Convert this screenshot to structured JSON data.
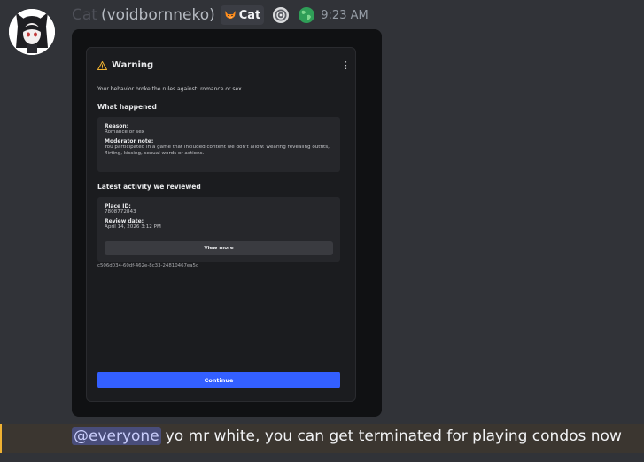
{
  "author": {
    "display_prefix": "Cat",
    "handle": "(voidbornneko)",
    "tag_label": "Cat",
    "time": "9:23 AM",
    "avatar_icon": "anime-cat-girl-avatar",
    "tag_icon": "fox-icon",
    "badge_icons": [
      "compass-badge-icon",
      "globe-icon"
    ]
  },
  "embed": {
    "title": "Warning",
    "intro": "Your behavior broke the rules against: romance or sex.",
    "what_happened": {
      "heading": "What happened",
      "reason_label": "Reason:",
      "reason_value": "Romance or sex",
      "note_label": "Moderator note:",
      "note_value": "You participated in a game that included content we don't allow: wearing revealing outfits, flirting, kissing, sexual words or actions."
    },
    "activity": {
      "heading": "Latest activity we reviewed",
      "place_label": "Place ID:",
      "place_value": "7808772843",
      "date_label": "Review date:",
      "date_value": "April 14, 2026 3:12 PM",
      "view_more": "View more"
    },
    "uuid": "c506d034-60df-462e-8c33-24810467ea5d",
    "continue": "Continue"
  },
  "message": {
    "mention": "@everyone",
    "text": "yo mr white, you can get terminated for playing condos now"
  },
  "colors": {
    "background": "#313338",
    "accent_button": "#335fff",
    "mention_bg": "#494d7a",
    "highlight_bar": "#f0b232",
    "warning": "#f0b232"
  }
}
